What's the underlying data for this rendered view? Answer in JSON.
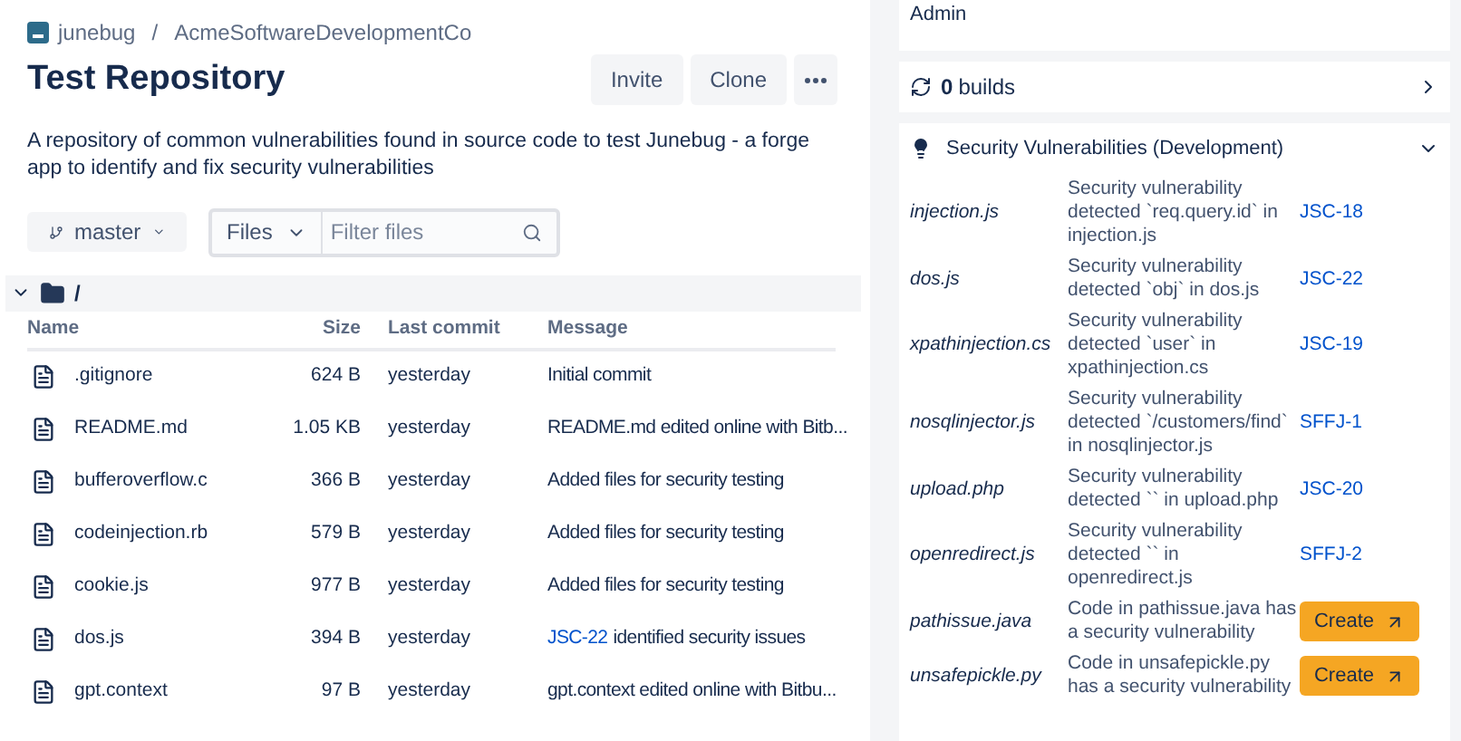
{
  "breadcrumb": {
    "workspace": "junebug",
    "separator": "/",
    "project": "AcmeSoftwareDevelopmentCo"
  },
  "title": "Test Repository",
  "actions": [
    "Invite",
    "Clone"
  ],
  "description": "A repository of common vulnerabilities found in source code to test Junebug - a forge app to identify and fix security vulnerabilities",
  "branch": "master",
  "filter": {
    "mode": "Files",
    "placeholder": "Filter files"
  },
  "folder": {
    "path": "/",
    "expanded": true
  },
  "table": {
    "columns": [
      "Name",
      "Size",
      "Last commit",
      "Message"
    ],
    "rows": [
      {
        "name": ".gitignore",
        "size": "624 B",
        "last_commit": "yesterday",
        "message": "Initial commit"
      },
      {
        "name": "README.md",
        "size": "1.05 KB",
        "last_commit": "yesterday",
        "message": "README.md edited online with Bitb..."
      },
      {
        "name": "bufferoverflow.c",
        "size": "366 B",
        "last_commit": "yesterday",
        "message": "Added files for security testing"
      },
      {
        "name": "codeinjection.rb",
        "size": "579 B",
        "last_commit": "yesterday",
        "message": "Added files for security testing"
      },
      {
        "name": "cookie.js",
        "size": "977 B",
        "last_commit": "yesterday",
        "message": "Added files for security testing"
      },
      {
        "name": "dos.js",
        "size": "394 B",
        "last_commit": "yesterday",
        "issue": "JSC-22",
        "message": "identified security issues"
      },
      {
        "name": "gpt.context",
        "size": "97 B",
        "last_commit": "yesterday",
        "message": "gpt.context edited online with Bitbu..."
      }
    ]
  },
  "sidebar": {
    "role": "Admin",
    "builds": {
      "count": "0",
      "label": "builds"
    },
    "vulnerabilities": {
      "title": "Security Vulnerabilities (Development)",
      "expanded": true,
      "items": [
        {
          "file": "injection.js",
          "description": "Security vulnerability detected `req.query.id` in injection.js",
          "kind": "issue",
          "issue": "JSC-18"
        },
        {
          "file": "dos.js",
          "description": "Security vulnerability detected `obj` in dos.js",
          "kind": "issue",
          "issue": "JSC-22"
        },
        {
          "file": "xpathinjection.cs",
          "description": "Security vulnerability detected `user` in xpathinjection.cs",
          "kind": "issue",
          "issue": "JSC-19"
        },
        {
          "file": "nosqlinjector.js",
          "description": "Security vulnerability detected `/customers/find` in nosqlinjector.js",
          "kind": "issue",
          "issue": "SFFJ-1"
        },
        {
          "file": "upload.php",
          "description": "Security vulnerability detected `` in upload.php",
          "kind": "issue",
          "issue": "JSC-20"
        },
        {
          "file": "openredirect.js",
          "description": "Security vulnerability detected `` in openredirect.js",
          "kind": "issue",
          "issue": "SFFJ-2"
        },
        {
          "file": "pathissue.java",
          "description": "Code in pathissue.java has a security vulnerability",
          "kind": "create",
          "action": "Create"
        },
        {
          "file": "unsafepickle.py",
          "description": "Code in unsafepickle.py has a security vulnerability",
          "kind": "create",
          "action": "Create"
        }
      ]
    }
  }
}
